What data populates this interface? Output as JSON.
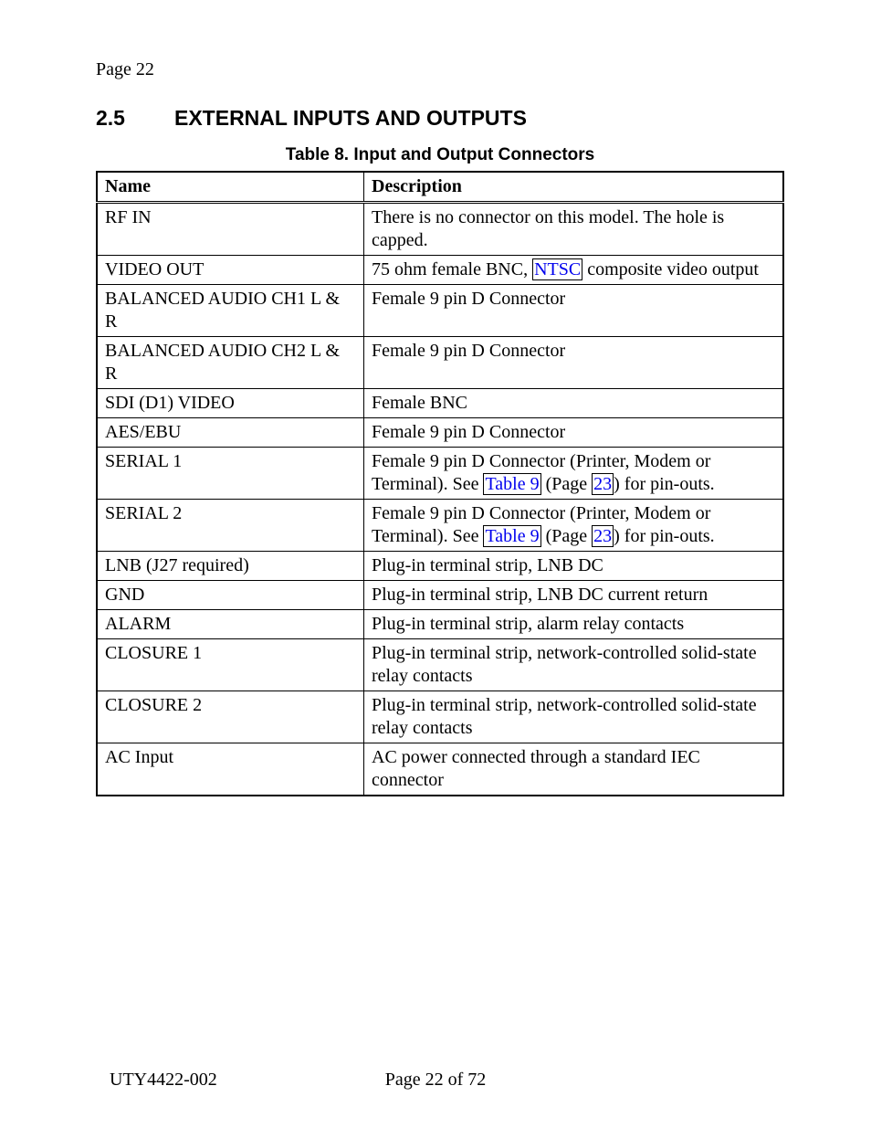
{
  "header": {
    "page_label": "Page 22"
  },
  "section": {
    "number": "2.5",
    "title": "EXTERNAL INPUTS AND OUTPUTS"
  },
  "table": {
    "caption": "Table 8.  Input and Output Connectors",
    "headers": {
      "name": "Name",
      "description": "Description"
    },
    "rows": [
      {
        "name": "RF IN",
        "description": "There is no connector on this model.  The hole is capped."
      },
      {
        "name": "VIDEO OUT",
        "desc_before": "75 ohm female BNC, ",
        "link": "NTSC",
        "desc_after": " composite video output"
      },
      {
        "name": "BALANCED AUDIO CH1 L & R",
        "description": "Female 9 pin D Connector"
      },
      {
        "name": "BALANCED AUDIO CH2 L & R",
        "description": "Female 9 pin D Connector"
      },
      {
        "name": "SDI (D1) VIDEO",
        "description": "Female BNC"
      },
      {
        "name": "AES/EBU",
        "description": "Female 9 pin D Connector"
      },
      {
        "name": "SERIAL 1",
        "desc_before": "Female 9 pin D Connector (Printer, Modem or Terminal).  See ",
        "link": "Table 9",
        "desc_mid": " (Page ",
        "link2": "23",
        "desc_after": ") for pin-outs."
      },
      {
        "name": "SERIAL 2",
        "desc_before": "Female 9 pin D Connector (Printer, Modem or Terminal).  See ",
        "link": "Table 9",
        "desc_mid": " (Page ",
        "link2": "23",
        "desc_after": ") for pin-outs."
      },
      {
        "name": "LNB (J27 required)",
        "description": "Plug-in terminal strip, LNB DC"
      },
      {
        "name": "GND",
        "description": "Plug-in terminal strip, LNB DC current return"
      },
      {
        "name": "ALARM",
        "description": "Plug-in terminal strip, alarm relay contacts"
      },
      {
        "name": "CLOSURE 1",
        "description": "Plug-in terminal strip, network-controlled solid-state relay contacts"
      },
      {
        "name": "CLOSURE 2",
        "description": "Plug-in terminal strip, network-controlled solid-state relay contacts"
      },
      {
        "name": "AC Input",
        "description": "AC power connected through a standard IEC connector"
      }
    ]
  },
  "footer": {
    "doc_id": "UTY4422-002",
    "page": "Page 22 of 72"
  }
}
